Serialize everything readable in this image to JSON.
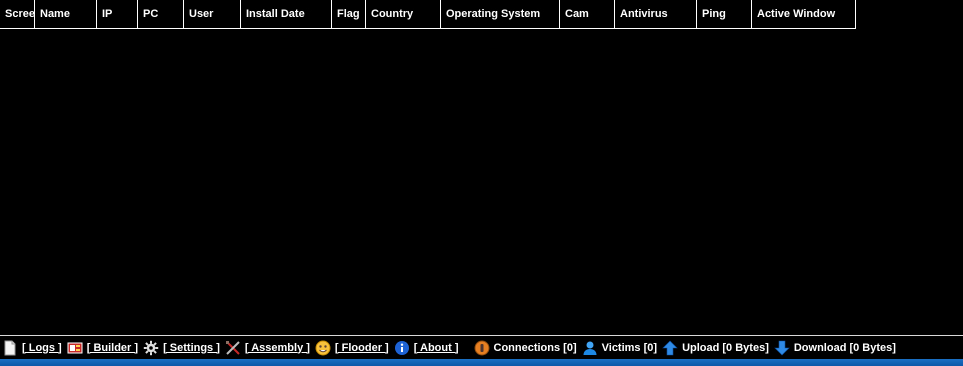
{
  "columns": [
    {
      "label": "Screen",
      "width": 35,
      "wrap": false
    },
    {
      "label": "Name",
      "width": 62,
      "wrap": false
    },
    {
      "label": "IP",
      "width": 41,
      "wrap": false
    },
    {
      "label": "PC",
      "width": 46,
      "wrap": false
    },
    {
      "label": "User",
      "width": 57,
      "wrap": false
    },
    {
      "label": "Install Date",
      "width": 91,
      "wrap": false
    },
    {
      "label": "Flag",
      "width": 34,
      "wrap": false
    },
    {
      "label": "Country",
      "width": 75,
      "wrap": false
    },
    {
      "label": "Operating System",
      "width": 119,
      "wrap": true
    },
    {
      "label": "Cam",
      "width": 55,
      "wrap": false
    },
    {
      "label": "Antivirus",
      "width": 82,
      "wrap": false
    },
    {
      "label": "Ping",
      "width": 55,
      "wrap": false
    },
    {
      "label": "Active Window",
      "width": 103,
      "wrap": true
    }
  ],
  "rows": [],
  "status_bar": {
    "logs": "[ Logs ]",
    "builder": "[ Builder ]",
    "settings": "[ Settings ]",
    "assembly": "[ Assembly ]",
    "flooder": "[ Flooder ]",
    "about": "[ About ]",
    "connections": "Connections [0]",
    "victims": "Victims [0]",
    "upload": "Upload [0 Bytes]",
    "download": "Download [0 Bytes]"
  },
  "colors": {
    "background": "#000000",
    "text": "#ffffff",
    "grid_line": "#ffffff",
    "bottom_strip": "#1a6fc4"
  }
}
